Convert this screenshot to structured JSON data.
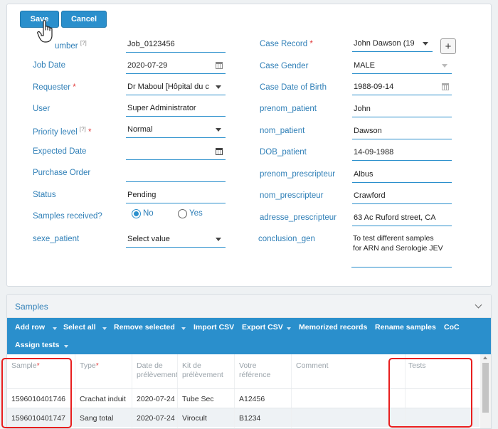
{
  "toolbar": {
    "save_label": "Save",
    "cancel_label": "Cancel"
  },
  "form": {
    "left": {
      "job_number_label": "umber",
      "job_number_help": "[?]",
      "job_number_value": "Job_0123456",
      "job_date_label": "Job Date",
      "job_date_value": "2020-07-29",
      "requester_label": "Requester",
      "requester_value": "Dr Maboul [Hôpital du c",
      "user_label": "User",
      "user_value": "Super Administrator",
      "priority_label": "Priority level",
      "priority_help": "[?]",
      "priority_value": "Normal",
      "expected_date_label": "Expected Date",
      "expected_date_value": "",
      "purchase_order_label": "Purchase Order",
      "purchase_order_value": "",
      "status_label": "Status",
      "status_value": "Pending",
      "samples_received_label": "Samples received?",
      "samples_received_no": "No",
      "samples_received_yes": "Yes",
      "samples_received_selected": "No",
      "sexe_patient_label": "sexe_patient",
      "sexe_patient_value": "Select value"
    },
    "right": {
      "case_record_label": "Case Record",
      "case_record_value": "John Dawson (19",
      "case_gender_label": "Case Gender",
      "case_gender_value": "MALE",
      "case_dob_label": "Case Date of Birth",
      "case_dob_value": "1988-09-14",
      "prenom_patient_label": "prenom_patient",
      "prenom_patient_value": "John",
      "nom_patient_label": "nom_patient",
      "nom_patient_value": "Dawson",
      "dob_patient_label": "DOB_patient",
      "dob_patient_value": "14-09-1988",
      "prenom_prescripteur_label": "prenom_prescripteur",
      "prenom_prescripteur_value": "Albus",
      "nom_prescripteur_label": "nom_prescripteur",
      "nom_prescripteur_value": "Crawford",
      "adresse_prescripteur_label": "adresse_prescripteur",
      "adresse_prescripteur_value": "63 Ac Ruford street, CA",
      "conclusion_gen_label": "conclusion_gen",
      "conclusion_gen_line1": "To test different samples",
      "conclusion_gen_line2": "for ARN and Serologie JEV"
    },
    "required_mark": "*"
  },
  "samples": {
    "title": "Samples",
    "actions": {
      "add_row": "Add row",
      "select_all": "Select all",
      "remove_selected": "Remove selected",
      "import_csv": "Import CSV",
      "export_csv": "Export CSV",
      "memorized_records": "Memorized records",
      "rename_samples": "Rename samples",
      "coc": "CoC",
      "assign_tests": "Assign tests"
    },
    "columns": {
      "sample": "Sample",
      "type": "Type",
      "date_line1": "Date de",
      "date_line2": "prélèvement",
      "kit_line1": "Kit de",
      "kit_line2": "prélèvement",
      "ref_line1": "Votre",
      "ref_line2": "référence",
      "comment": "Comment",
      "tests": "Tests"
    },
    "rows": [
      {
        "sample": "1596010401746",
        "type": "Crachat induit",
        "date": "2020-07-24",
        "kit": "Tube Sec",
        "reference": "A12456",
        "comment": "",
        "tests": ""
      },
      {
        "sample": "1596010401747",
        "type": "Sang total",
        "date": "2020-07-24",
        "kit": "Virocult",
        "reference": "B1234",
        "comment": "",
        "tests": ""
      }
    ]
  },
  "colors": {
    "accent": "#2a8fcc",
    "label": "#2f7fb7",
    "required": "#e23b3b",
    "highlight": "#e81e1e"
  },
  "icons": [
    "hand-pointer-icon",
    "calendar-icon",
    "dropdown-caret-icon",
    "plus-icon",
    "chevron-down-icon"
  ]
}
